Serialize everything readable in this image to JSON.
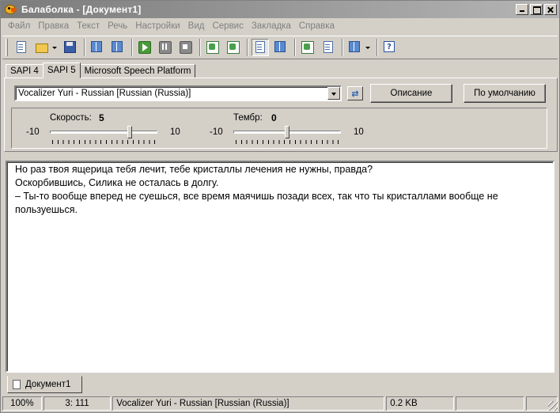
{
  "window": {
    "title": "Балаболка - [Документ1]"
  },
  "menu": [
    "Файл",
    "Правка",
    "Текст",
    "Речь",
    "Настройки",
    "Вид",
    "Сервис",
    "Закладка",
    "Справка"
  ],
  "toolbar": {
    "icons": [
      "new-document-icon",
      "open-folder-icon",
      "save-icon",
      "read-aloud-icon",
      "read-clipboard-icon",
      "play-icon",
      "pause-icon",
      "stop-icon",
      "speak-selection-icon",
      "speak-file-icon",
      "text-options-icon",
      "split-view-icon",
      "convert-icon",
      "export-icon",
      "batch-icon",
      "help-icon"
    ]
  },
  "engine_tabs": [
    {
      "label": "SAPI 4",
      "active": false
    },
    {
      "label": "SAPI 5",
      "active": true
    },
    {
      "label": "Microsoft Speech Platform",
      "active": false
    }
  ],
  "voice": {
    "selected": "Vocalizer Yuri - Russian [Russian (Russia)]",
    "describe_label": "Описание",
    "default_label": "По умолчанию"
  },
  "speed": {
    "label": "Скорость:",
    "value": "5",
    "min": "-10",
    "max": "10",
    "level": 5
  },
  "pitch": {
    "label": "Тембр:",
    "value": "0",
    "min": "-10",
    "max": "10",
    "level": 0
  },
  "editor": {
    "lines": [
      "Но раз твоя ящерица тебя лечит, тебе кристаллы лечения не нужны, правда?",
      "Оскорбившись, Силика не осталась в долгу.",
      "– Ты-то вообще вперед не суешься, все время маячишь позади всех, так что ты кристаллами вообще не пользуешься."
    ]
  },
  "document_tab": {
    "label": "Документ1"
  },
  "status": {
    "zoom": "100%",
    "position": "3: 111",
    "voice": "Vocalizer Yuri - Russian [Russian (Russia)]",
    "size": "0.2 KB"
  }
}
